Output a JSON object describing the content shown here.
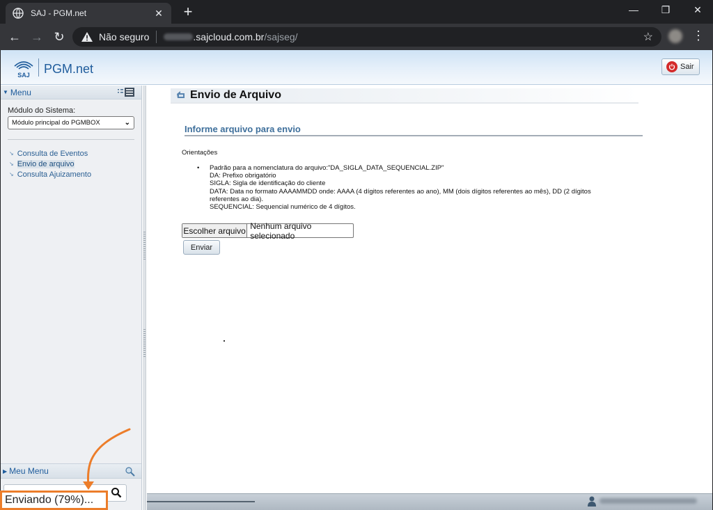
{
  "browser": {
    "tab_title": "SAJ - PGM.net",
    "tab_close": "✕",
    "new_tab": "+",
    "security_label": "Não seguro",
    "url_host": ".sajcloud.com.br",
    "url_path": "/sajseg/",
    "minimize": "—",
    "restore": "❐",
    "close": "✕",
    "back": "←",
    "forward": "→",
    "reload": "↻",
    "bookmark": "☆",
    "menu": "⋮"
  },
  "header": {
    "logo_text": "SAJ",
    "app_name": "PGM.net",
    "exit_label": "Sair"
  },
  "sidebar": {
    "menu_title": "Menu",
    "modulo_label": "Módulo do Sistema:",
    "modulo_selected": "Módulo principal do PGMBOX",
    "items": [
      {
        "label": "Consulta de Eventos"
      },
      {
        "label": "Envio de arquivo"
      },
      {
        "label": "Consulta Ajuizamento"
      }
    ],
    "meu_menu_title": "Meu Menu"
  },
  "main": {
    "page_title": "Envio de Arquivo",
    "section_title": "Informe arquivo para envio",
    "orientacoes_label": "Orientações",
    "orientacoes_lines": [
      "Padrão para a nomenclatura do arquivo:\"DA_SIGLA_DATA_SEQUENCIAL.ZIP\"",
      "DA: Prefixo obrigatório",
      "SIGLA: Sigla de identificação do cliente",
      "DATA: Data no formato AAAAMMDD onde: AAAA (4 dígitos referentes ao ano), MM (dois dígitos referentes ao mês), DD (2 dígitos",
      "referentes ao dia).",
      "SEQUENCIAL: Sequencial numérico de 4 dígitos."
    ],
    "file_button": "Escolher arquivo",
    "file_status": "Nenhum arquivo selecionado",
    "submit": "Enviar"
  },
  "status": {
    "upload_progress_text": "Enviando (79%)...",
    "upload_progress_percent": 79
  },
  "colors": {
    "annotation": "#ec7d2a",
    "link": "#2a5f93",
    "section_title": "#3e6f9b"
  },
  "icons": [
    "globe-icon",
    "warning-icon",
    "star-icon",
    "power-icon",
    "list-icon",
    "search-icon",
    "user-icon",
    "title-arrow-icon"
  ]
}
